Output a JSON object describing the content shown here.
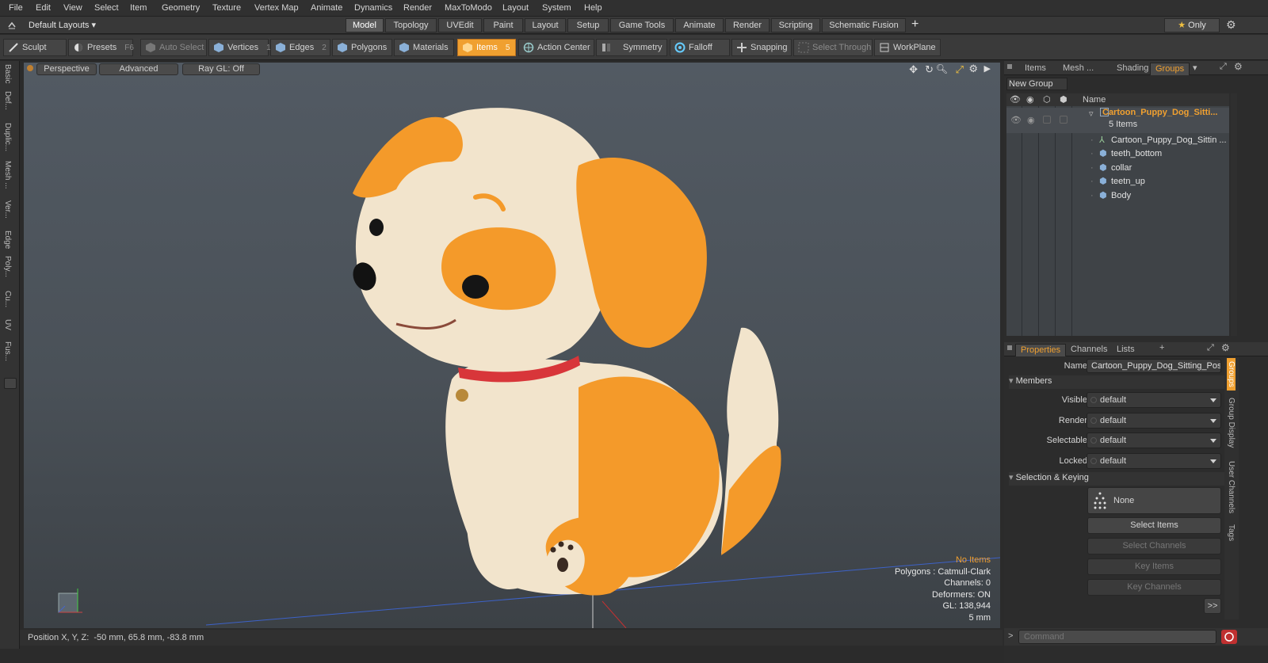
{
  "menubar": {
    "items": [
      "File",
      "Edit",
      "View",
      "Select",
      "Item",
      "Geometry",
      "Texture",
      "Vertex Map",
      "Animate",
      "Dynamics",
      "Render",
      "MaxToModo",
      "Layout",
      "System",
      "Help"
    ]
  },
  "layout_bar": {
    "layout_selector": "Default Layouts",
    "tabs": [
      "Model",
      "Topology",
      "UVEdit",
      "Paint",
      "Layout",
      "Setup",
      "Game Tools",
      "Animate",
      "Render",
      "Scripting",
      "Schematic Fusion"
    ],
    "active_tab": "Model",
    "add_label": "+",
    "only_label": "Only"
  },
  "toolbar": {
    "sculpt": "Sculpt",
    "presets": "Presets",
    "presets_key": "F6",
    "auto_select": "Auto Select",
    "vertices": "Vertices",
    "vertices_key": "1",
    "edges": "Edges",
    "edges_key": "2",
    "polygons": "Polygons",
    "materials": "Materials",
    "items": "Items",
    "items_key": "5",
    "action_center": "Action Center",
    "symmetry": "Symmetry",
    "falloff": "Falloff",
    "snapping": "Snapping",
    "select_through": "Select Through",
    "workplane": "WorkPlane"
  },
  "left_tabs": [
    "Basic",
    "Def...",
    "Duplic...",
    "Mesh ...",
    "Ver...",
    "Edge",
    "Poly...",
    "Cu...",
    "UV",
    "Fus..."
  ],
  "viewport": {
    "view_mode": "Perspective",
    "shading": "Advanced",
    "raygl": "Ray GL: Off",
    "hud": {
      "selection": "No Items",
      "polygons": "Polygons : Catmull-Clark",
      "channels": "Channels: 0",
      "deformers": "Deformers: ON",
      "gl": "GL: 138,944",
      "scale": "5 mm"
    }
  },
  "statusbar": {
    "position": "Position X, Y, Z:  -50 mm, 65.8 mm, -83.8 mm"
  },
  "groups_panel": {
    "tabs": [
      "Items",
      "Mesh ...",
      "Shading",
      "Groups"
    ],
    "active_tab": "Groups",
    "new_group": "New Group",
    "name_header": "Name",
    "group_name": "Cartoon_Puppy_Dog_Sitti...",
    "group_count": "5 Items",
    "children": [
      "Cartoon_Puppy_Dog_Sittin ...",
      "teeth_bottom",
      "collar",
      "teetn_up",
      "Body"
    ]
  },
  "properties_panel": {
    "tabs": [
      "Properties",
      "Channels",
      "Lists"
    ],
    "active_tab": "Properties",
    "add_label": "+",
    "name_label": "Name",
    "name_value": "Cartoon_Puppy_Dog_Sitting_Pos",
    "members_section": "Members",
    "visible_label": "Visible",
    "visible_value": "default",
    "render_label": "Render",
    "render_value": "default",
    "selectable_label": "Selectable",
    "selectable_value": "default",
    "locked_label": "Locked",
    "locked_value": "default",
    "selection_section": "Selection & Keying",
    "none_label": "None",
    "select_items": "Select Items",
    "select_channels": "Select Channels",
    "key_items": "Key Items",
    "key_channels": "Key Channels",
    "more": ">>",
    "side_tabs": [
      "Groups",
      "Group Display",
      "User Channels",
      "Tags"
    ]
  },
  "command": {
    "placeholder": "Command"
  },
  "colors": {
    "accent": "#f0a030",
    "viewport_top": "#525a63",
    "viewport_bottom": "#3c4146",
    "dog_orange": "#f49a2a",
    "dog_cream": "#f2e4cc",
    "collar_red": "#d8363a"
  }
}
